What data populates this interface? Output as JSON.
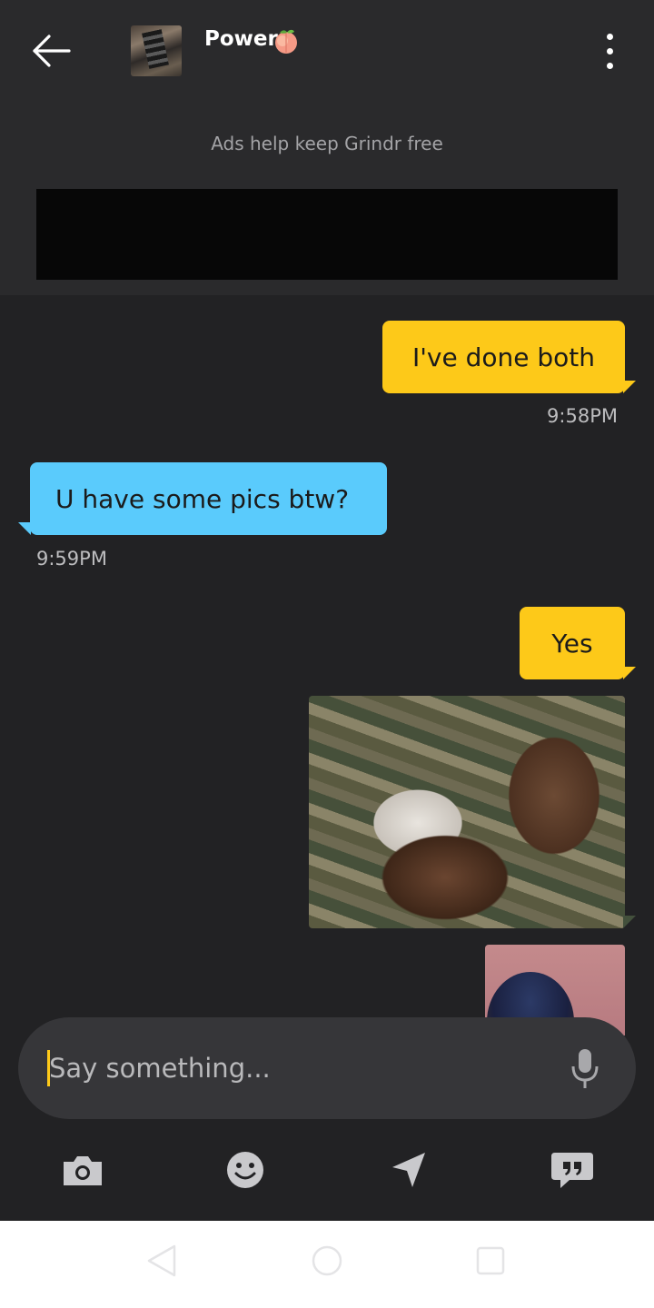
{
  "header": {
    "profile_name": "Power",
    "status_emoji_icon": "peach-icon",
    "back_icon": "arrow-left-icon",
    "menu_icon": "more-vertical-icon"
  },
  "ads": {
    "note": "Ads help keep Grindr free"
  },
  "messages": [
    {
      "direction": "outgoing",
      "type": "text",
      "text": "I've done both",
      "time": "9:58PM"
    },
    {
      "direction": "incoming",
      "type": "text",
      "text": "U have some pics btw?",
      "time": "9:59PM"
    },
    {
      "direction": "outgoing",
      "type": "text",
      "text": "Yes"
    },
    {
      "direction": "outgoing",
      "type": "image"
    },
    {
      "direction": "outgoing",
      "type": "image"
    }
  ],
  "composer": {
    "placeholder": "Say something...",
    "value": ""
  },
  "toolbar": [
    "camera-icon",
    "emoji-icon",
    "location-icon",
    "saved-phrases-icon"
  ],
  "colors": {
    "background": "#222224",
    "header": "#2a2a2c",
    "outgoing_bubble": "#fdc919",
    "incoming_bubble": "#5acbfc",
    "accent": "#fdc919"
  }
}
